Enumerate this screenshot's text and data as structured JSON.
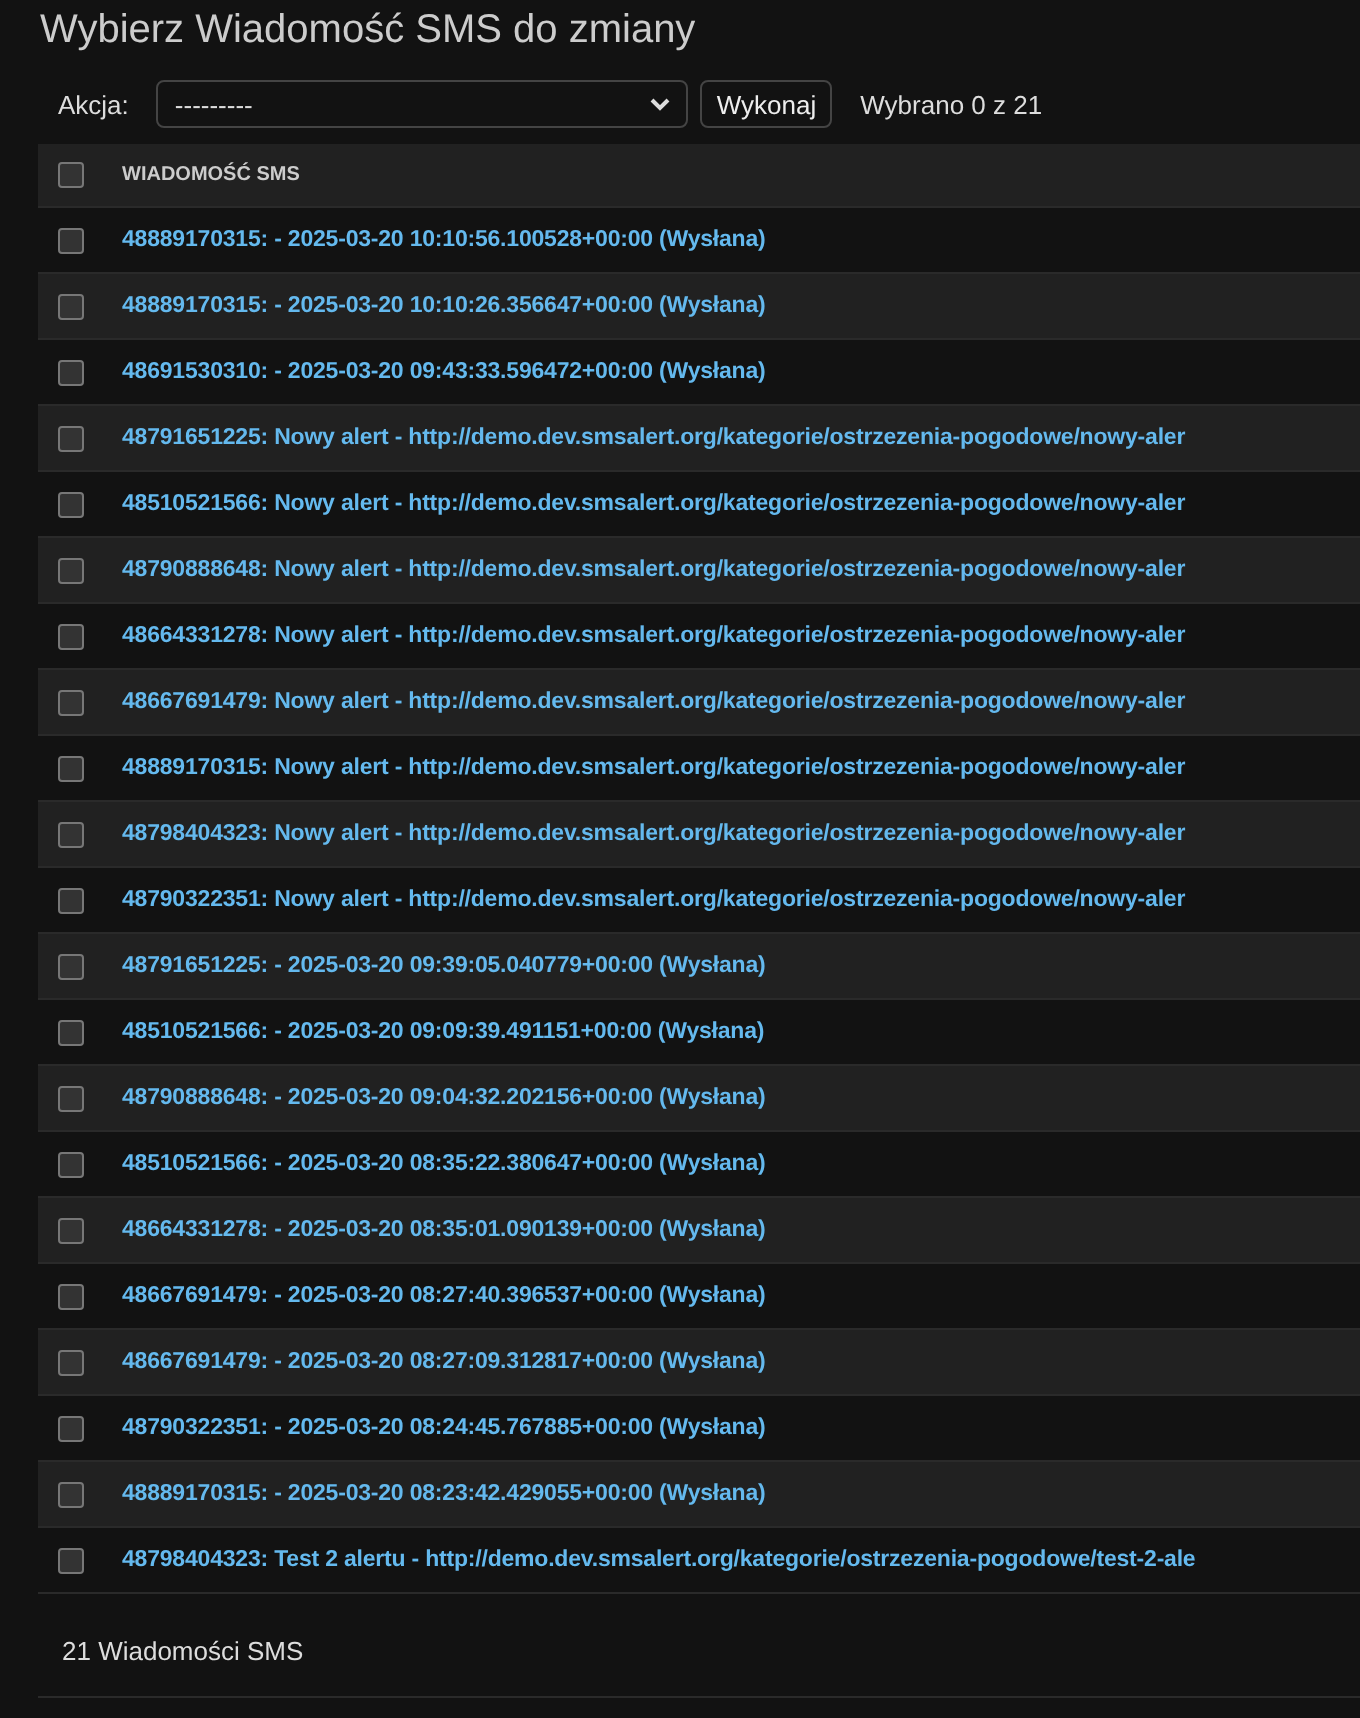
{
  "title": "Wybierz Wiadomość SMS do zmiany",
  "actions": {
    "label": "Akcja:",
    "value": "---------",
    "button": "Wykonaj",
    "selection_count": "Wybrano 0 z 21"
  },
  "table": {
    "select_all_checked": false,
    "column": "WIADOMOŚĆ SMS",
    "rows": [
      {
        "text": "48889170315: - 2025-03-20 10:10:56.100528+00:00 (Wysłana)",
        "checked": false
      },
      {
        "text": "48889170315: - 2025-03-20 10:10:26.356647+00:00 (Wysłana)",
        "checked": false
      },
      {
        "text": "48691530310: - 2025-03-20 09:43:33.596472+00:00 (Wysłana)",
        "checked": false
      },
      {
        "text": "48791651225: Nowy alert - http://demo.dev.smsalert.org/kategorie/ostrzezenia-pogodowe/nowy-aler",
        "checked": false
      },
      {
        "text": "48510521566: Nowy alert - http://demo.dev.smsalert.org/kategorie/ostrzezenia-pogodowe/nowy-aler",
        "checked": false
      },
      {
        "text": "48790888648: Nowy alert - http://demo.dev.smsalert.org/kategorie/ostrzezenia-pogodowe/nowy-aler",
        "checked": false
      },
      {
        "text": "48664331278: Nowy alert - http://demo.dev.smsalert.org/kategorie/ostrzezenia-pogodowe/nowy-aler",
        "checked": false
      },
      {
        "text": "48667691479: Nowy alert - http://demo.dev.smsalert.org/kategorie/ostrzezenia-pogodowe/nowy-aler",
        "checked": false
      },
      {
        "text": "48889170315: Nowy alert - http://demo.dev.smsalert.org/kategorie/ostrzezenia-pogodowe/nowy-aler",
        "checked": false
      },
      {
        "text": "48798404323: Nowy alert - http://demo.dev.smsalert.org/kategorie/ostrzezenia-pogodowe/nowy-aler",
        "checked": false
      },
      {
        "text": "48790322351: Nowy alert - http://demo.dev.smsalert.org/kategorie/ostrzezenia-pogodowe/nowy-aler",
        "checked": false
      },
      {
        "text": "48791651225: - 2025-03-20 09:39:05.040779+00:00 (Wysłana)",
        "checked": false
      },
      {
        "text": "48510521566: - 2025-03-20 09:09:39.491151+00:00 (Wysłana)",
        "checked": false
      },
      {
        "text": "48790888648: - 2025-03-20 09:04:32.202156+00:00 (Wysłana)",
        "checked": false
      },
      {
        "text": "48510521566: - 2025-03-20 08:35:22.380647+00:00 (Wysłana)",
        "checked": false
      },
      {
        "text": "48664331278: - 2025-03-20 08:35:01.090139+00:00 (Wysłana)",
        "checked": false
      },
      {
        "text": "48667691479: - 2025-03-20 08:27:40.396537+00:00 (Wysłana)",
        "checked": false
      },
      {
        "text": "48667691479: - 2025-03-20 08:27:09.312817+00:00 (Wysłana)",
        "checked": false
      },
      {
        "text": "48790322351: - 2025-03-20 08:24:45.767885+00:00 (Wysłana)",
        "checked": false
      },
      {
        "text": "48889170315: - 2025-03-20 08:23:42.429055+00:00 (Wysłana)",
        "checked": false
      },
      {
        "text": "48798404323: Test 2 alertu - http://demo.dev.smsalert.org/kategorie/ostrzezenia-pogodowe/test-2-ale",
        "checked": false
      }
    ]
  },
  "footer": "21 Wiadomości SMS"
}
